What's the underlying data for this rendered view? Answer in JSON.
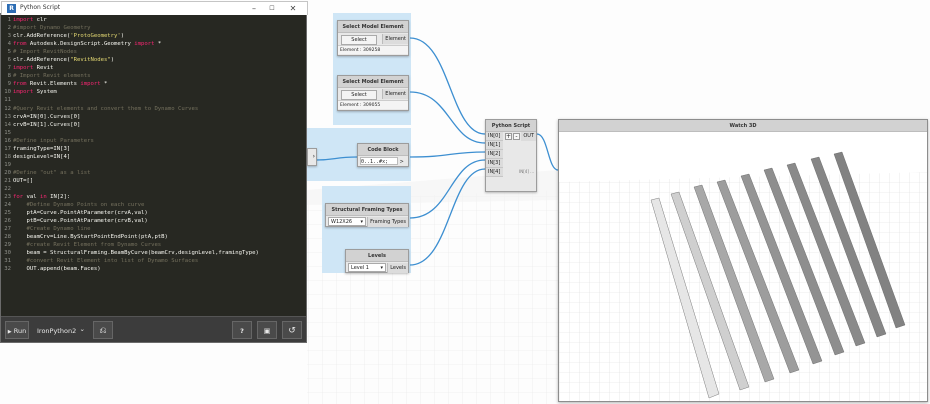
{
  "editor": {
    "title": "Python Script",
    "logo": "R",
    "window_controls": [
      "–",
      "☐",
      "✕"
    ],
    "lines": [
      {
        "n": "1",
        "parts": [
          [
            "kw",
            "import"
          ],
          [
            "tx",
            " clr"
          ]
        ]
      },
      {
        "n": "2",
        "parts": [
          [
            "cm",
            "#import Dynamo Geometry"
          ]
        ]
      },
      {
        "n": "3",
        "parts": [
          [
            "tx",
            "clr.AddReference("
          ],
          [
            "st",
            "'ProtoGeometry'"
          ],
          [
            "tx",
            ")"
          ]
        ]
      },
      {
        "n": "4",
        "parts": [
          [
            "kw",
            "from"
          ],
          [
            "tx",
            " Autodesk.DesignScript.Geometry "
          ],
          [
            "kw",
            "import"
          ],
          [
            "tx",
            " *"
          ]
        ]
      },
      {
        "n": "5",
        "parts": [
          [
            "cm",
            "# Import RevitNodes"
          ]
        ]
      },
      {
        "n": "6",
        "parts": [
          [
            "tx",
            "clr.AddReference("
          ],
          [
            "st",
            "\"RevitNodes\""
          ],
          [
            "tx",
            ")"
          ]
        ]
      },
      {
        "n": "7",
        "parts": [
          [
            "kw",
            "import"
          ],
          [
            "tx",
            " Revit"
          ]
        ]
      },
      {
        "n": "8",
        "parts": [
          [
            "cm",
            "# Import Revit elements"
          ]
        ]
      },
      {
        "n": "9",
        "parts": [
          [
            "kw",
            "from"
          ],
          [
            "tx",
            " Revit.Elements "
          ],
          [
            "kw",
            "import"
          ],
          [
            "tx",
            " *"
          ]
        ]
      },
      {
        "n": "10",
        "parts": [
          [
            "kw",
            "import"
          ],
          [
            "tx",
            " System"
          ]
        ]
      },
      {
        "n": "11",
        "parts": []
      },
      {
        "n": "12",
        "parts": [
          [
            "cm",
            "#Query Revit elements and convert them to Dynamo Curves"
          ]
        ]
      },
      {
        "n": "13",
        "parts": [
          [
            "tx",
            "crvA=IN[0].Curves[0]"
          ]
        ]
      },
      {
        "n": "14",
        "parts": [
          [
            "tx",
            "crvB=IN[1].Curves[0]"
          ]
        ]
      },
      {
        "n": "15",
        "parts": []
      },
      {
        "n": "16",
        "parts": [
          [
            "cm",
            "#Define input Parameters"
          ]
        ]
      },
      {
        "n": "17",
        "parts": [
          [
            "tx",
            "framingType=IN[3]"
          ]
        ]
      },
      {
        "n": "18",
        "parts": [
          [
            "tx",
            "designLevel=IN[4]"
          ]
        ]
      },
      {
        "n": "19",
        "parts": []
      },
      {
        "n": "20",
        "parts": [
          [
            "cm",
            "#Define \"out\" as a list"
          ]
        ]
      },
      {
        "n": "21",
        "parts": [
          [
            "tx",
            "OUT=[]"
          ]
        ]
      },
      {
        "n": "22",
        "parts": []
      },
      {
        "n": "23",
        "parts": [
          [
            "kw",
            "for"
          ],
          [
            "tx",
            " val "
          ],
          [
            "kw",
            "in"
          ],
          [
            "tx",
            " IN[2]:"
          ]
        ]
      },
      {
        "n": "24",
        "parts": [
          [
            "cm",
            "    #Define Dynamo Points on each curve"
          ]
        ]
      },
      {
        "n": "25",
        "parts": [
          [
            "tx",
            "    ptA=Curve.PointAtParameter(crvA,val)"
          ]
        ]
      },
      {
        "n": "26",
        "parts": [
          [
            "tx",
            "    ptB=Curve.PointAtParameter(crvB,val)"
          ]
        ]
      },
      {
        "n": "27",
        "parts": [
          [
            "cm",
            "    #Create Dynamo line"
          ]
        ]
      },
      {
        "n": "28",
        "parts": [
          [
            "tx",
            "    beamCrv=Line.ByStartPointEndPoint(ptA,ptB)"
          ]
        ]
      },
      {
        "n": "29",
        "parts": [
          [
            "cm",
            "    #create Revit Element from Dynamo Curves"
          ]
        ]
      },
      {
        "n": "30",
        "parts": [
          [
            "tx",
            "    beam = StructuralFraming.BeamByCurve(beamCrv,designLevel,framingType)"
          ]
        ]
      },
      {
        "n": "31",
        "parts": [
          [
            "cm",
            "    #convert Revit Element into list of Dynamo Surfaces"
          ]
        ]
      },
      {
        "n": "32",
        "parts": [
          [
            "tx",
            "    OUT.append(beam.Faces)"
          ]
        ]
      }
    ],
    "toolbar": {
      "run_label": "Run",
      "engine_label": "IronPython2",
      "engine_caret": "⌄",
      "help_glyph": "?",
      "save_glyph": "💾",
      "revert_glyph": "↺"
    }
  },
  "nodes": {
    "select1": {
      "title": "Select Model Element",
      "button": "Select",
      "out": "Element",
      "footer": "Element : 309258"
    },
    "select2": {
      "title": "Select Model Element",
      "button": "Select",
      "out": "Element",
      "footer": "Element : 309055"
    },
    "code_block": {
      "title": "Code Block",
      "code": "0..1..#x;",
      "out": ">"
    },
    "framing": {
      "title": "Structural Framing Types",
      "selected": "W12X26",
      "out": "Framing Types"
    },
    "levels": {
      "title": "Levels",
      "selected": "Level 1",
      "out": "Levels"
    },
    "python": {
      "title": "Python Script",
      "inputs": [
        "IN[0]",
        "IN[1]",
        "IN[2]",
        "IN[3]",
        "IN[4]"
      ],
      "add": "+",
      "remove": "-",
      "out": "OUT",
      "footer": "IN[4] ..."
    },
    "watch3d": {
      "title": "Watch 3D"
    }
  },
  "colors": {
    "wire": "#3d8fd1",
    "group": "#cfe6f6",
    "editor_bg": "#272822",
    "keyword": "#f92672",
    "comment": "#75715e",
    "string": "#e6db74"
  }
}
